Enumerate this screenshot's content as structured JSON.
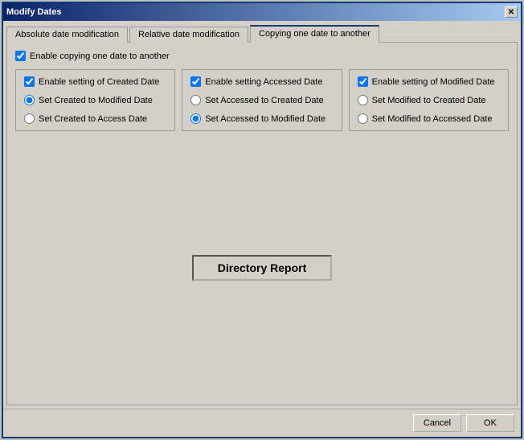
{
  "window": {
    "title": "Modify Dates",
    "close_label": "✕"
  },
  "tabs": [
    {
      "id": "absolute",
      "label": "Absolute date modification",
      "active": false
    },
    {
      "id": "relative",
      "label": "Relative date modification",
      "active": false
    },
    {
      "id": "copying",
      "label": "Copying one date to another",
      "active": true
    }
  ],
  "enable_copy_label": "Enable copying one date to another",
  "panels": [
    {
      "id": "created",
      "enable_label": "Enable setting of Created Date",
      "enable_checked": true,
      "options": [
        {
          "id": "created_to_modified",
          "label": "Set Created to Modified Date",
          "checked": true
        },
        {
          "id": "created_to_access",
          "label": "Set Created to Access Date",
          "checked": false
        }
      ]
    },
    {
      "id": "accessed",
      "enable_label": "Enable setting Accessed Date",
      "enable_checked": true,
      "options": [
        {
          "id": "accessed_to_created",
          "label": "Set Accessed to Created Date",
          "checked": false
        },
        {
          "id": "accessed_to_modified",
          "label": "Set Accessed to Modified Date",
          "checked": true
        }
      ]
    },
    {
      "id": "modified",
      "enable_label": "Enable setting of Modified Date",
      "enable_checked": true,
      "options": [
        {
          "id": "modified_to_created",
          "label": "Set Modified to Created Date",
          "checked": false
        },
        {
          "id": "modified_to_accessed",
          "label": "Set Modified to Accessed Date",
          "checked": false
        }
      ]
    }
  ],
  "directory_report_label": "Directory Report",
  "buttons": {
    "cancel": "Cancel",
    "ok": "OK"
  }
}
